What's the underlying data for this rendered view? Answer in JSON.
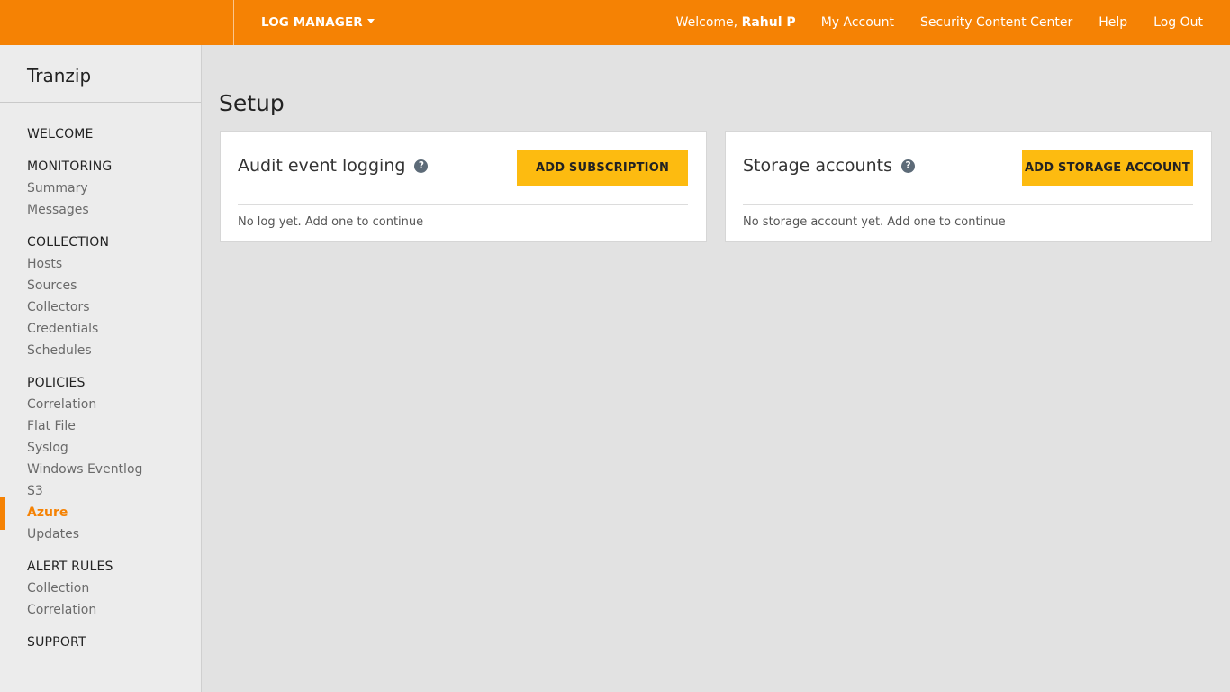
{
  "header": {
    "app_switcher_label": "LOG MANAGER",
    "welcome_prefix": "Welcome, ",
    "user_name": "Rahul P",
    "links": {
      "my_account": "My Account",
      "security_content_center": "Security Content Center",
      "help": "Help",
      "log_out": "Log Out"
    }
  },
  "sidebar": {
    "org_name": "Tranzip",
    "welcome": "WELCOME",
    "monitoring": {
      "title": "MONITORING",
      "items": [
        "Summary",
        "Messages"
      ]
    },
    "collection": {
      "title": "COLLECTION",
      "items": [
        "Hosts",
        "Sources",
        "Collectors",
        "Credentials",
        "Schedules"
      ]
    },
    "policies": {
      "title": "POLICIES",
      "items": [
        "Correlation",
        "Flat File",
        "Syslog",
        "Windows Eventlog",
        "S3",
        "Azure",
        "Updates"
      ],
      "active": "Azure"
    },
    "alert_rules": {
      "title": "ALERT RULES",
      "items": [
        "Collection",
        "Correlation"
      ]
    },
    "support": "SUPPORT"
  },
  "main": {
    "title": "Setup",
    "cards": [
      {
        "title": "Audit event logging",
        "button": "ADD SUBSCRIPTION",
        "empty_text": "No log yet. Add one to continue"
      },
      {
        "title": "Storage accounts",
        "button": "ADD STORAGE ACCOUNT",
        "empty_text": "No storage account yet. Add one to continue"
      }
    ]
  },
  "icons": {
    "help": "question-circle-icon",
    "dropdown": "caret-down-icon"
  },
  "colors": {
    "brand": "#f58204",
    "button": "#fdbb10",
    "help_icon": "#5d6b78"
  }
}
